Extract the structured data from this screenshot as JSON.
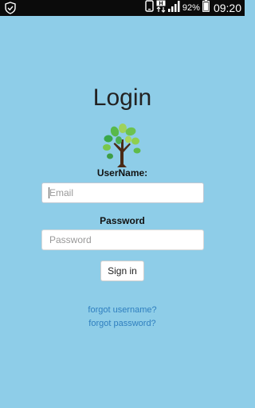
{
  "status_bar": {
    "left_icon": "shield-notification-icon",
    "battery_percent": "92%",
    "time": "09:20",
    "network_label": "H",
    "icons": [
      "phone-icon",
      "data-arrows-icon",
      "signal-icon",
      "battery-icon"
    ]
  },
  "login": {
    "title": "Login",
    "logo_icon": "tree-logo-icon",
    "username_label": "UserName:",
    "email_placeholder": "Email",
    "password_label": "Password",
    "password_placeholder": "Password",
    "signin_label": "Sign in",
    "forgot_username": "forgot username?",
    "forgot_password": "forgot password?"
  },
  "colors": {
    "background": "#8ecde8",
    "status_bar": "#0b0b0b",
    "link": "#2f7fbf"
  }
}
